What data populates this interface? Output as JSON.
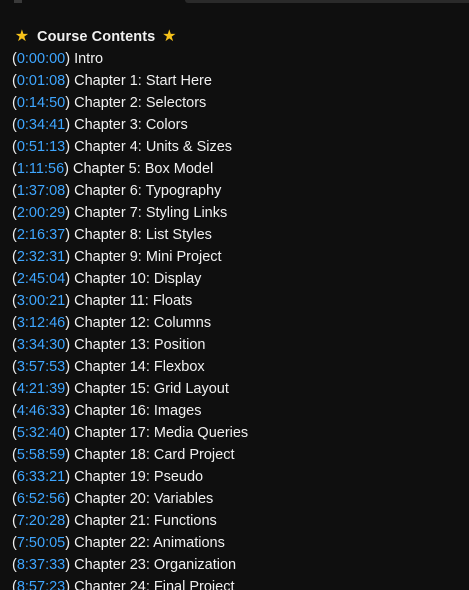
{
  "heading": {
    "star_left": "★",
    "title": "Course Contents",
    "star_right": "★"
  },
  "colors": {
    "background": "#0f0f0f",
    "text": "#f1f1f1",
    "timestamp_link": "#3ea6ff",
    "star": "#f6c21a"
  },
  "chapters": [
    {
      "time": "0:00:00",
      "title": "Intro"
    },
    {
      "time": "0:01:08",
      "title": "Chapter 1: Start Here"
    },
    {
      "time": "0:14:50",
      "title": "Chapter 2: Selectors"
    },
    {
      "time": "0:34:41",
      "title": "Chapter 3: Colors"
    },
    {
      "time": "0:51:13",
      "title": "Chapter 4: Units & Sizes"
    },
    {
      "time": "1:11:56",
      "title": "Chapter 5: Box Model"
    },
    {
      "time": "1:37:08",
      "title": "Chapter 6: Typography"
    },
    {
      "time": "2:00:29",
      "title": "Chapter 7: Styling Links"
    },
    {
      "time": "2:16:37",
      "title": "Chapter 8: List Styles"
    },
    {
      "time": "2:32:31",
      "title": "Chapter 9: Mini Project"
    },
    {
      "time": "2:45:04",
      "title": "Chapter 10: Display"
    },
    {
      "time": "3:00:21",
      "title": "Chapter 11: Floats"
    },
    {
      "time": "3:12:46",
      "title": "Chapter 12: Columns"
    },
    {
      "time": "3:34:30",
      "title": "Chapter 13: Position"
    },
    {
      "time": "3:57:53",
      "title": "Chapter 14: Flexbox"
    },
    {
      "time": "4:21:39",
      "title": "Chapter 15: Grid Layout"
    },
    {
      "time": "4:46:33",
      "title": "Chapter 16: Images"
    },
    {
      "time": "5:32:40",
      "title": "Chapter 17: Media Queries"
    },
    {
      "time": "5:58:59",
      "title": "Chapter 18: Card Project"
    },
    {
      "time": "6:33:21",
      "title": "Chapter 19: Pseudo"
    },
    {
      "time": "6:52:56",
      "title": "Chapter 20: Variables"
    },
    {
      "time": "7:20:28",
      "title": "Chapter 21: Functions"
    },
    {
      "time": "7:50:05",
      "title": "Chapter 22: Animations"
    },
    {
      "time": "8:37:33",
      "title": "Chapter 23: Organization"
    },
    {
      "time": "8:57:23",
      "title": "Chapter 24: Final Project"
    }
  ]
}
